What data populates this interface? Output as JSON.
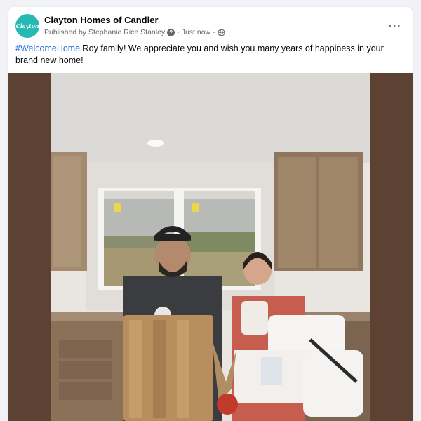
{
  "post": {
    "page_name": "Clayton Homes of Candler",
    "avatar_text": "Clayton",
    "published_by": "Published by Stephanie Rice Stanley",
    "separator": "·",
    "time": "Just now",
    "more_label": "···",
    "hashtag": "#WelcomeHome",
    "body": " Roy family!  We appreciate you and wish you many years of happiness in your brand new home!"
  },
  "icons": {
    "info": "question-circle-icon",
    "audience": "globe-icon",
    "more": "ellipsis-icon"
  },
  "colors": {
    "brand": "#24b9b3",
    "link": "#216fdb",
    "meta": "#65676b"
  }
}
